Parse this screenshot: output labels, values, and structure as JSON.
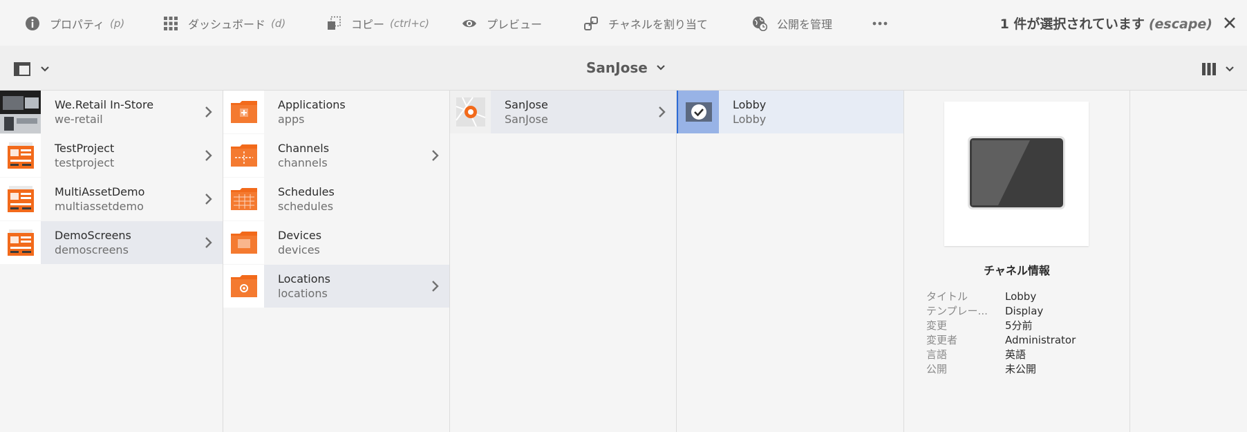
{
  "actionbar": {
    "items": [
      {
        "icon": "info-icon",
        "label": "プロパティ",
        "shortcut": "(p)"
      },
      {
        "icon": "grid-icon",
        "label": "ダッシュボード",
        "shortcut": "(d)"
      },
      {
        "icon": "copy-icon",
        "label": "コピー",
        "shortcut": "(ctrl+c)"
      },
      {
        "icon": "eye-icon",
        "label": "プレビュー",
        "shortcut": ""
      },
      {
        "icon": "link-icon",
        "label": "チャネルを割り当て",
        "shortcut": ""
      },
      {
        "icon": "globe-clock-icon",
        "label": "公開を管理",
        "shortcut": ""
      }
    ],
    "selection_text": "1 件が選択されています",
    "selection_shortcut": "(escape)"
  },
  "subbar": {
    "title": "SanJose"
  },
  "columns": [
    {
      "rows": [
        {
          "title": "We.Retail In-Store",
          "name": "we-retail",
          "thumb": "photo",
          "active": false,
          "chevron": true
        },
        {
          "title": "TestProject",
          "name": "testproject",
          "thumb": "project",
          "active": false,
          "chevron": true
        },
        {
          "title": "MultiAssetDemo",
          "name": "multiassetdemo",
          "thumb": "project",
          "active": false,
          "chevron": true
        },
        {
          "title": "DemoScreens",
          "name": "demoscreens",
          "thumb": "project",
          "active": true,
          "chevron": true
        }
      ]
    },
    {
      "rows": [
        {
          "title": "Applications",
          "name": "apps",
          "thumb": "folder",
          "active": false,
          "chevron": false
        },
        {
          "title": "Channels",
          "name": "channels",
          "thumb": "folder",
          "active": false,
          "chevron": true
        },
        {
          "title": "Schedules",
          "name": "schedules",
          "thumb": "folder",
          "active": false,
          "chevron": false
        },
        {
          "title": "Devices",
          "name": "devices",
          "thumb": "folder",
          "active": false,
          "chevron": false
        },
        {
          "title": "Locations",
          "name": "locations",
          "thumb": "folder",
          "active": true,
          "chevron": true
        }
      ]
    },
    {
      "rows": [
        {
          "title": "SanJose",
          "name": "SanJose",
          "thumb": "location",
          "active": true,
          "chevron": true
        }
      ]
    },
    {
      "rows": [
        {
          "title": "Lobby",
          "name": "Lobby",
          "thumb": "check",
          "active": true,
          "chevron": false
        }
      ]
    }
  ],
  "info": {
    "title": "チャネル情報",
    "meta": [
      {
        "key": "タイトル",
        "value": "Lobby"
      },
      {
        "key": "テンプレー...",
        "value": "Display"
      },
      {
        "key": "変更",
        "value": "5分前"
      },
      {
        "key": "変更者",
        "value": "Administrator"
      },
      {
        "key": "言語",
        "value": "英語"
      },
      {
        "key": "公開",
        "value": "未公開"
      }
    ]
  },
  "colors": {
    "accent_orange": "#f26a1b",
    "selection_blue": "#98b3e6",
    "active_row": "#e7e9ee"
  }
}
